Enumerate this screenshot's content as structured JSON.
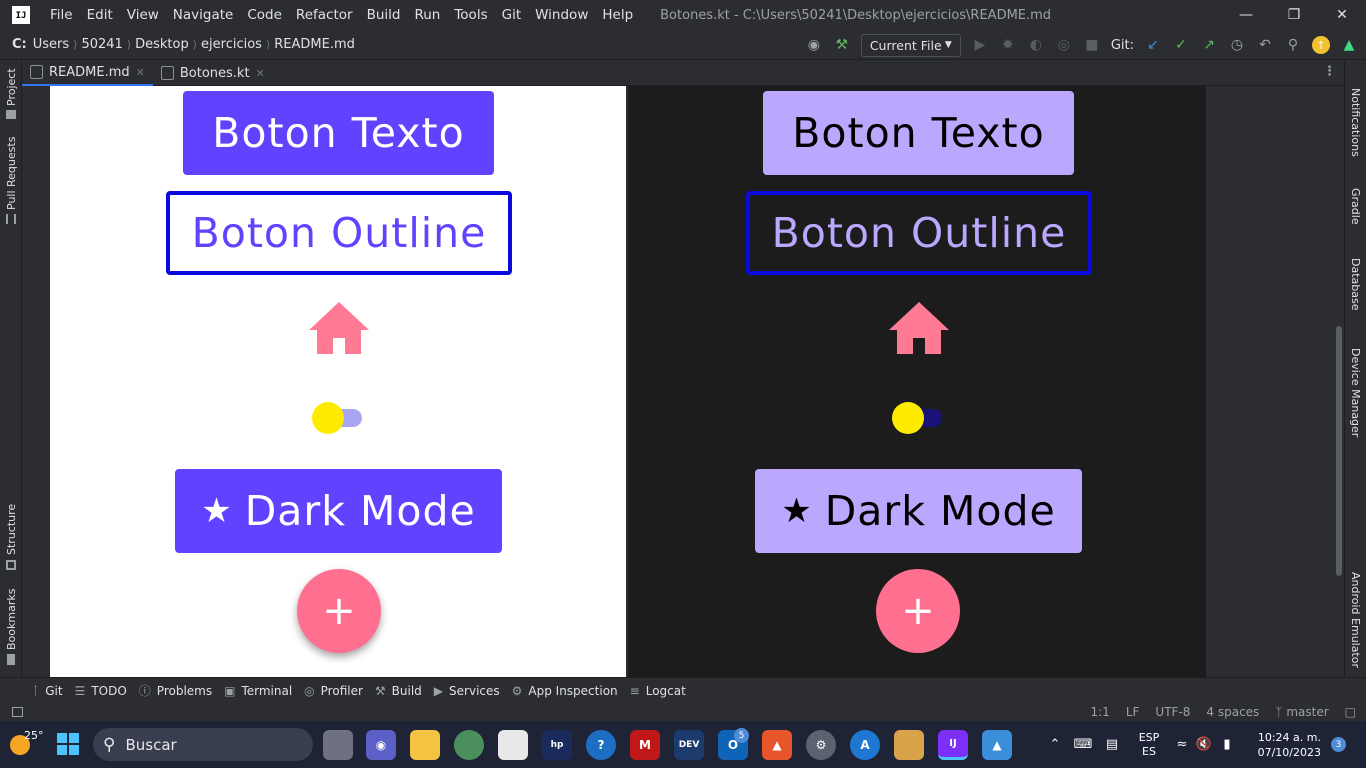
{
  "app": {
    "logo_text": "IJ",
    "window_title": "Botones.kt - C:\\Users\\50241\\Desktop\\ejercicios\\README.md",
    "menu": [
      "File",
      "Edit",
      "View",
      "Navigate",
      "Code",
      "Refactor",
      "Build",
      "Run",
      "Tools",
      "Git",
      "Window",
      "Help"
    ]
  },
  "navbar": {
    "drive": "C:",
    "breadcrumb": [
      "Users",
      "50241",
      "Desktop",
      "ejercicios",
      "README.md"
    ],
    "run_config": "Current File",
    "git_label": "Git:"
  },
  "tabs": [
    {
      "label": "README.md",
      "active": true
    },
    {
      "label": "Botones.kt",
      "active": false
    }
  ],
  "left_tools": [
    "Project",
    "Pull Requests",
    "Structure",
    "Bookmarks"
  ],
  "right_tools": [
    "Notifications",
    "Gradle",
    "Database",
    "Device Manager",
    "Android Emulator"
  ],
  "preview": {
    "light": {
      "button_text": "Boton Texto",
      "outline_text": "Boton Outline",
      "dark_mode_text": "Dark Mode",
      "star": "★",
      "fab_icon": "+",
      "colors": {
        "bg": "#ffffff",
        "button": "#6342ff",
        "button_text": "#ffffff",
        "outline_border": "#0a0adc",
        "outline_text": "#6342ff",
        "home": "#ff7b95",
        "switch_track": "#a8a6f3",
        "switch_thumb": "#ffeb00",
        "fab": "#ff6f90"
      }
    },
    "dark": {
      "button_text": "Boton Texto",
      "outline_text": "Boton Outline",
      "dark_mode_text": "Dark Mode",
      "star": "★",
      "fab_icon": "+",
      "colors": {
        "bg": "#1c1c1c",
        "button": "#bca7ff",
        "button_text": "#000000",
        "outline_border": "#0a0adc",
        "outline_text": "#bca7ff",
        "home": "#ff7b95",
        "switch_track": "#19127a",
        "switch_thumb": "#ffeb00",
        "fab": "#ff6f90"
      }
    }
  },
  "tool_windows": [
    "Git",
    "TODO",
    "Problems",
    "Terminal",
    "Profiler",
    "Build",
    "Services",
    "App Inspection",
    "Logcat"
  ],
  "status": {
    "position": "1:1",
    "line_sep": "LF",
    "encoding": "UTF-8",
    "indent": "4 spaces",
    "branch": "master"
  },
  "taskbar": {
    "weather_temp": "25°",
    "search_placeholder": "Buscar",
    "mail_badge": "5",
    "lang": "ESP",
    "lang_sub": "ES",
    "time": "10:24 a. m.",
    "date": "07/10/2023",
    "notif_count": "3"
  }
}
